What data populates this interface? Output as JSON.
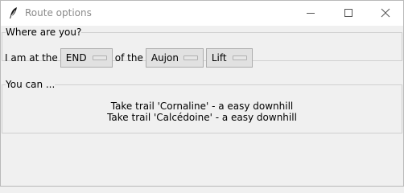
{
  "window": {
    "title": "Route options",
    "icon": "feather-icon",
    "controls": [
      "minimize-icon",
      "maximize-icon",
      "close-icon"
    ]
  },
  "location": {
    "legend": "Where are you?",
    "prefix": "I am at the",
    "position": "END",
    "of_label": "of the",
    "place": "Aujon",
    "kind": "Lift"
  },
  "options": {
    "legend": "You can ...",
    "items": [
      "Take trail 'Cornaline' - a easy downhill",
      "Take trail 'Calcédoine' - a easy downhill"
    ]
  }
}
